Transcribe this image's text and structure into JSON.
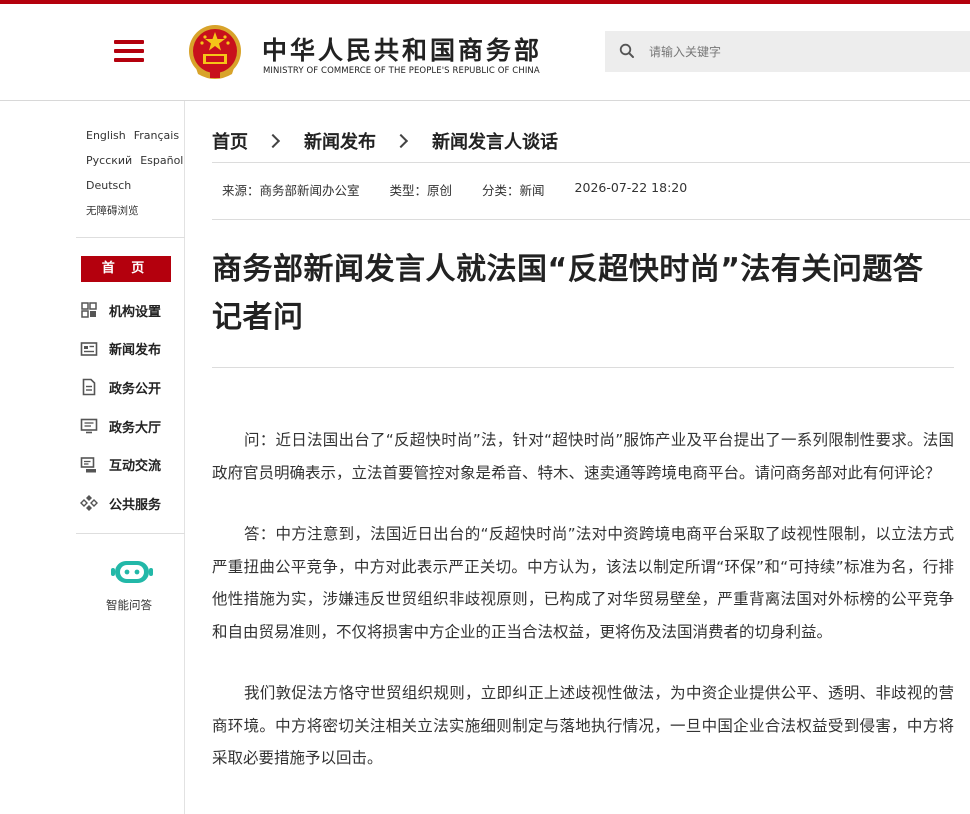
{
  "header": {
    "title_cn": "中华人民共和国商务部",
    "title_en": "MINISTRY OF COMMERCE OF THE PEOPLE'S REPUBLIC OF CHINA",
    "search_placeholder": "请输入关键字",
    "brand_color": "#b4000d",
    "icons": {
      "menu": "menu-icon",
      "emblem": "national-emblem-icon",
      "search": "search-icon"
    }
  },
  "sidebar": {
    "languages": [
      {
        "label": "English"
      },
      {
        "label": "Français"
      },
      {
        "label": "Русский"
      },
      {
        "label": "Español"
      },
      {
        "label": "Deutsch"
      },
      {
        "label": "无障碍浏览"
      }
    ],
    "home_label": "首 页",
    "items": [
      {
        "label": "机构设置",
        "icon": "org-structure-icon"
      },
      {
        "label": "新闻发布",
        "icon": "news-icon"
      },
      {
        "label": "政务公开",
        "icon": "document-icon"
      },
      {
        "label": "政务大厅",
        "icon": "service-hall-icon"
      },
      {
        "label": "互动交流",
        "icon": "chat-icon"
      },
      {
        "label": "公共服务",
        "icon": "public-service-icon"
      }
    ],
    "assistant_label": "智能问答"
  },
  "breadcrumb": [
    {
      "label": "首页"
    },
    {
      "label": "新闻发布"
    },
    {
      "label": "新闻发言人谈话"
    }
  ],
  "meta": {
    "source": "来源：商务部新闻办公室",
    "type": "类型：原创",
    "category": "分类：新闻",
    "datetime": "2026-07-22 18:20"
  },
  "article": {
    "title": "商务部新闻发言人就法国“反超快时尚”法有关问题答记者问",
    "paragraphs": [
      "问：近日法国出台了“反超快时尚”法，针对“超快时尚”服饰产业及平台提出了一系列限制性要求。法国政府官员明确表示，立法首要管控对象是希音、特木、速卖通等跨境电商平台。请问商务部对此有何评论？",
      "答：中方注意到，法国近日出台的“反超快时尚”法对中资跨境电商平台采取了歧视性限制，以立法方式严重扭曲公平竞争，中方对此表示严正关切。中方认为，该法以制定所谓“环保”和“可持续”标准为名，行排他性措施为实，涉嫌违反世贸组织非歧视原则，已构成了对华贸易壁垒，严重背离法国对外标榜的公平竞争和自由贸易准则，不仅将损害中方企业的正当合法权益，更将伤及法国消费者的切身利益。",
      "我们敦促法方恪守世贸组织规则，立即纠正上述歧视性做法，为中资企业提供公平、透明、非歧视的营商环境。中方将密切关注相关立法实施细则制定与落地执行情况，一旦中国企业合法权益受到侵害，中方将采取必要措施予以回击。"
    ]
  }
}
